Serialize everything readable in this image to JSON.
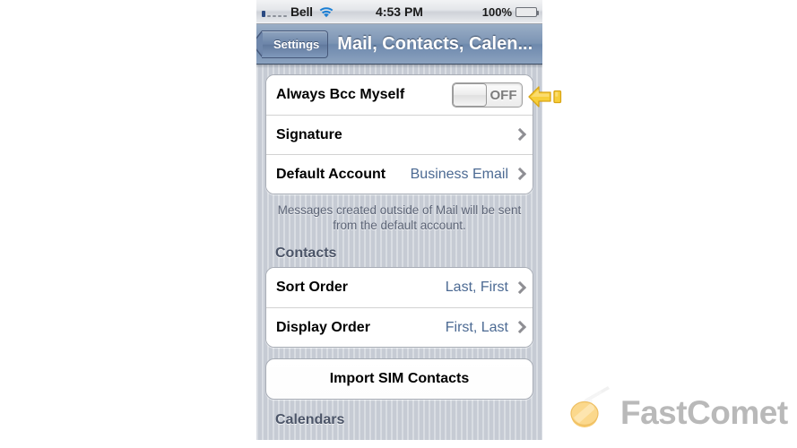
{
  "statusbar": {
    "carrier": "Bell",
    "signal_icon": "signal-bars-icon",
    "wifi_icon": "wifi-icon",
    "time": "4:53 PM",
    "battery_percent": "100%",
    "battery_icon": "battery-full-icon"
  },
  "navbar": {
    "back_label": "Settings",
    "back_icon": "chevron-left-icon",
    "title": "Mail, Contacts, Calen..."
  },
  "mail_group": {
    "rows": [
      {
        "label": "Always Bcc Myself",
        "control": "toggle",
        "toggle_state": "OFF",
        "toggle_label": "OFF"
      },
      {
        "label": "Signature",
        "control": "disclosure",
        "value": "",
        "chevron_icon": "chevron-right-icon"
      },
      {
        "label": "Default Account",
        "control": "disclosure",
        "value": "Business Email",
        "chevron_icon": "chevron-right-icon"
      }
    ],
    "note": "Messages created outside of Mail will be sent from the default account."
  },
  "contacts_section": {
    "header": "Contacts",
    "rows": [
      {
        "label": "Sort Order",
        "value": "Last, First",
        "chevron_icon": "chevron-right-icon"
      },
      {
        "label": "Display Order",
        "value": "First, Last",
        "chevron_icon": "chevron-right-icon"
      }
    ],
    "import_button": "Import SIM Contacts"
  },
  "calendars_section": {
    "header": "Calendars"
  },
  "annotation": {
    "icon": "left-arrow-callout-icon",
    "color": "#f5c11e"
  },
  "watermark": {
    "brand": "FastComet",
    "icon": "comet-icon",
    "text_color": "#b9b9b9",
    "comet_color": "#f7c96b"
  },
  "colors": {
    "nav_blue": "#7c94b4",
    "value_text": "#4c6a93",
    "section_header": "#4c5568",
    "battery_green": "#78c832"
  }
}
